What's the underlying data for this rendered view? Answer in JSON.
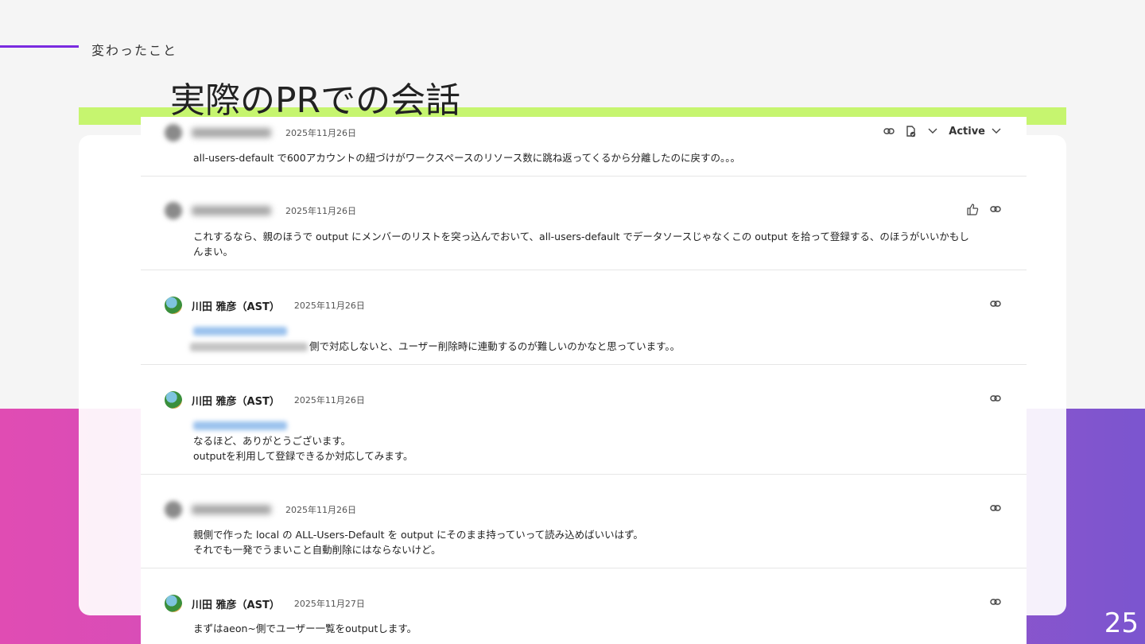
{
  "slide": {
    "section_label": "変わったこと",
    "title": "実際のPRでの会話",
    "page_number": "25"
  },
  "thread": {
    "status_label": "Active",
    "comments": [
      {
        "author": "",
        "author_visible": false,
        "date": "2025年11月26日",
        "lines": [
          "all-users-default で600アカウントの紐づけがワークスペースのリソース数に跳ね返ってくるから分離したのに戻すの。。。"
        ]
      },
      {
        "author": "",
        "author_visible": false,
        "date": "2025年11月26日",
        "lines": [
          "これするなら、親のほうで output にメンバーのリストを突っ込んでおいて、all-users-default でデータソースじゃなくこの output を拾って登録する、のほうがいいかもし",
          "んまい。"
        ]
      },
      {
        "author": "川田 雅彦（AST）",
        "author_visible": true,
        "date": "2025年11月26日",
        "lines": [
          "側で対応しないと、ユーザー削除時に連動するのが難しいのかなと思っています。。"
        ]
      },
      {
        "author": "川田 雅彦（AST）",
        "author_visible": true,
        "date": "2025年11月26日",
        "lines": [
          "なるほど、ありがとうございます。",
          "outputを利用して登録できるか対応してみます。"
        ]
      },
      {
        "author": "",
        "author_visible": false,
        "date": "2025年11月26日",
        "lines": [
          "親側で作った local の ALL-Users-Default を output にそのまま持っていって読み込めばいいはず。",
          "それでも一発でうまいこと自動削除にはならないけど。"
        ]
      },
      {
        "author": "川田 雅彦（AST）",
        "author_visible": true,
        "date": "2025年11月27日",
        "lines": [
          "まずはaeon~側でユーザー一覧をoutputします。"
        ]
      }
    ]
  },
  "icons": {
    "link": "link-icon",
    "resolve": "resolve-status-icon",
    "chevron": "chevron-down-icon",
    "like": "thumbs-up-icon"
  },
  "colors": {
    "accent_line": "#7a2be0",
    "accent_bar": "#c6f56f",
    "band_left": "#e04cb3",
    "band_right": "#7b55cf"
  }
}
